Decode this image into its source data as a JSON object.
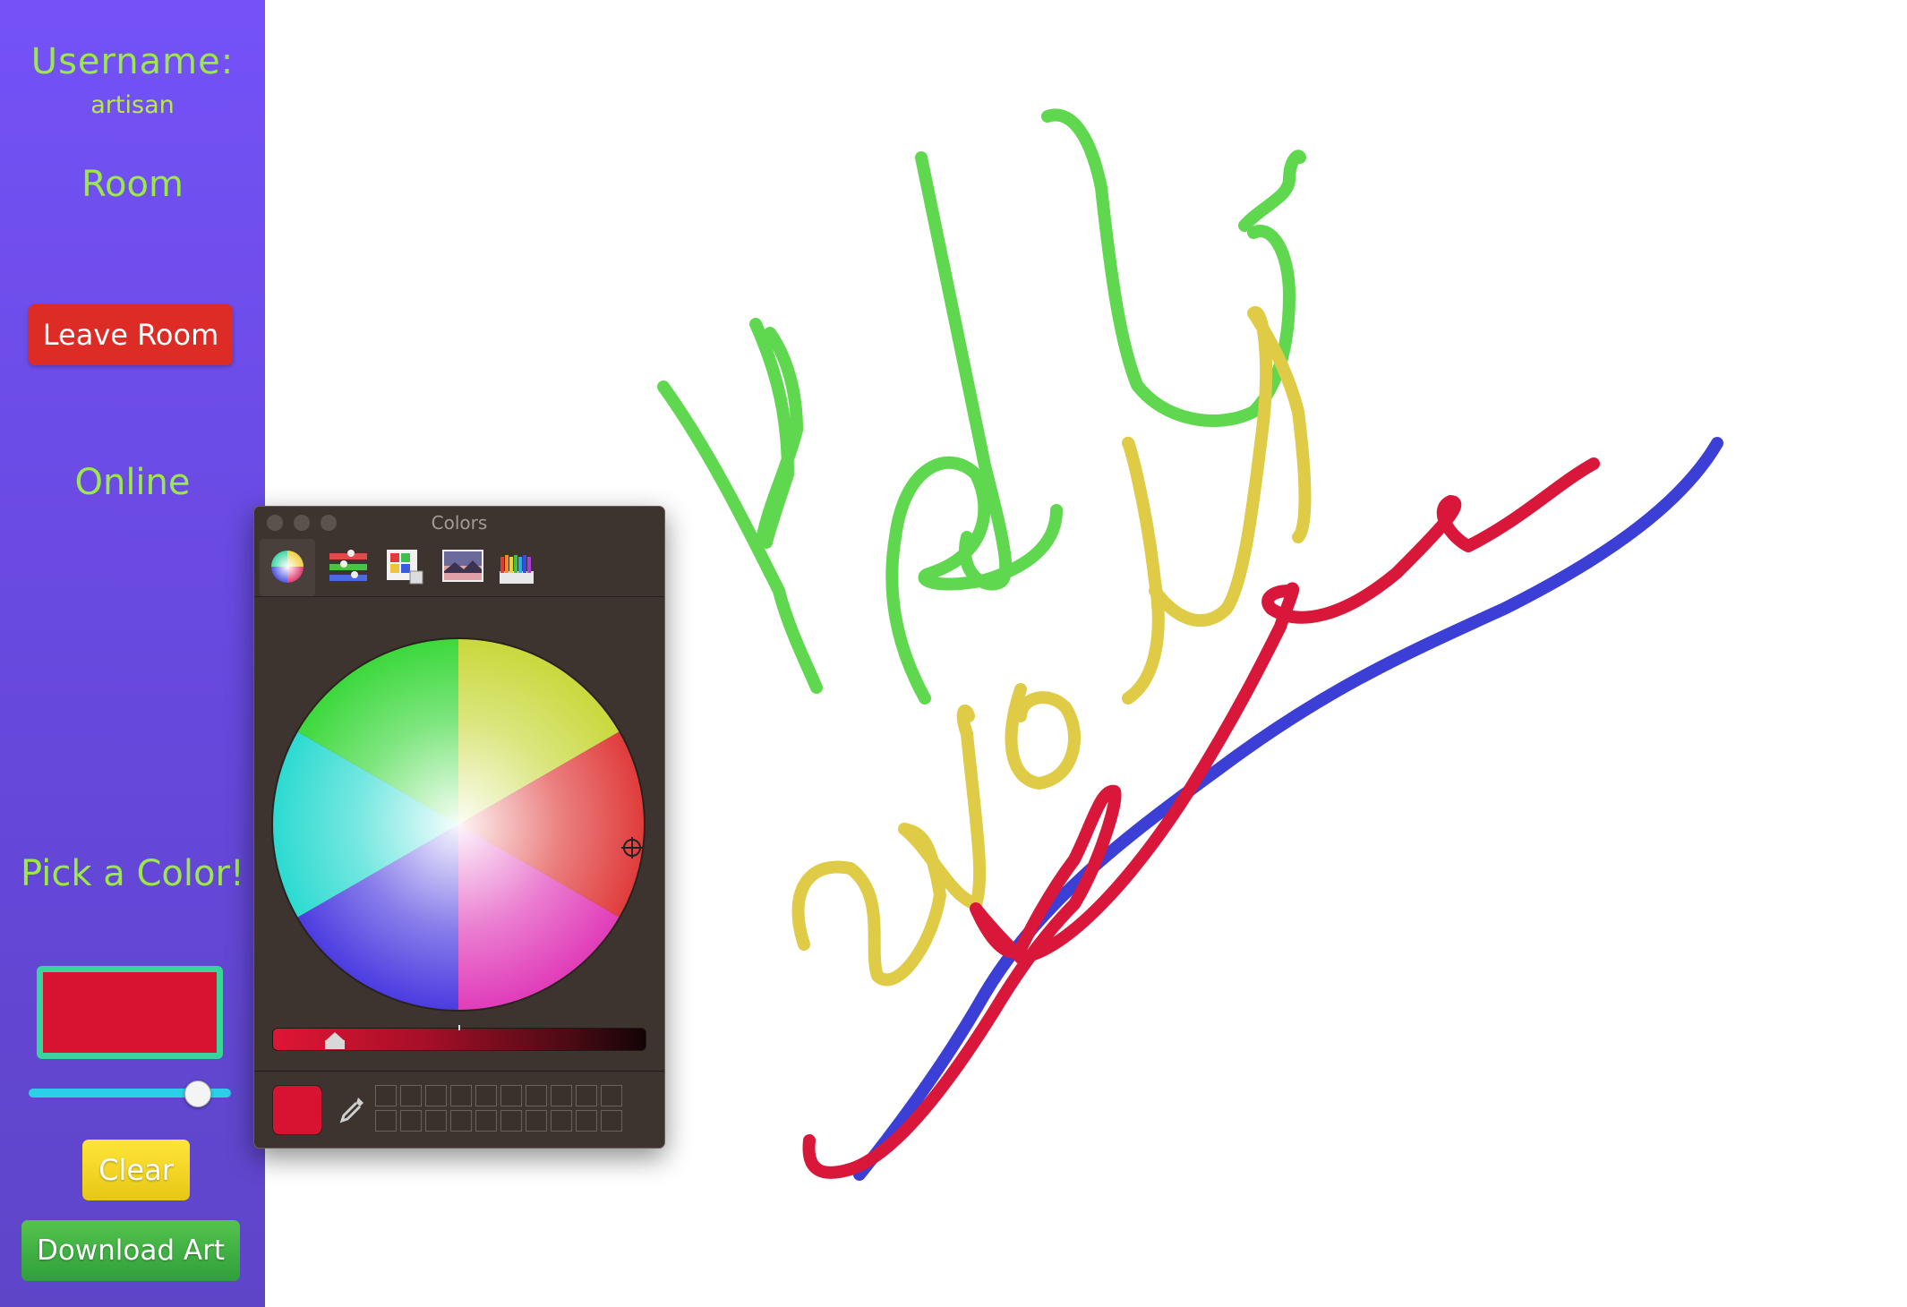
{
  "sidebar": {
    "username_label": "Username:",
    "username_value": "artisan",
    "room_label": "Room",
    "leave_button": "Leave Room",
    "online_label": "Online",
    "pick_color_label": "Pick a Color!",
    "current_color": "#d71331",
    "brush_size_fraction": 0.82,
    "clear_button": "Clear",
    "download_button": "Download Art"
  },
  "colors_panel": {
    "title": "Colors",
    "tabs": [
      "color-wheel-icon",
      "color-sliders-icon",
      "color-palettes-icon",
      "image-palettes-icon",
      "pencils-icon"
    ],
    "selected_color": "#d71331",
    "brightness_fraction": 0.12
  },
  "canvas": {
    "strokes": [
      "green",
      "yellow",
      "blue",
      "red"
    ],
    "colors": {
      "green": "#5fd84f",
      "yellow": "#dfcb46",
      "blue": "#3b3fd6",
      "red": "#d9173a"
    }
  }
}
